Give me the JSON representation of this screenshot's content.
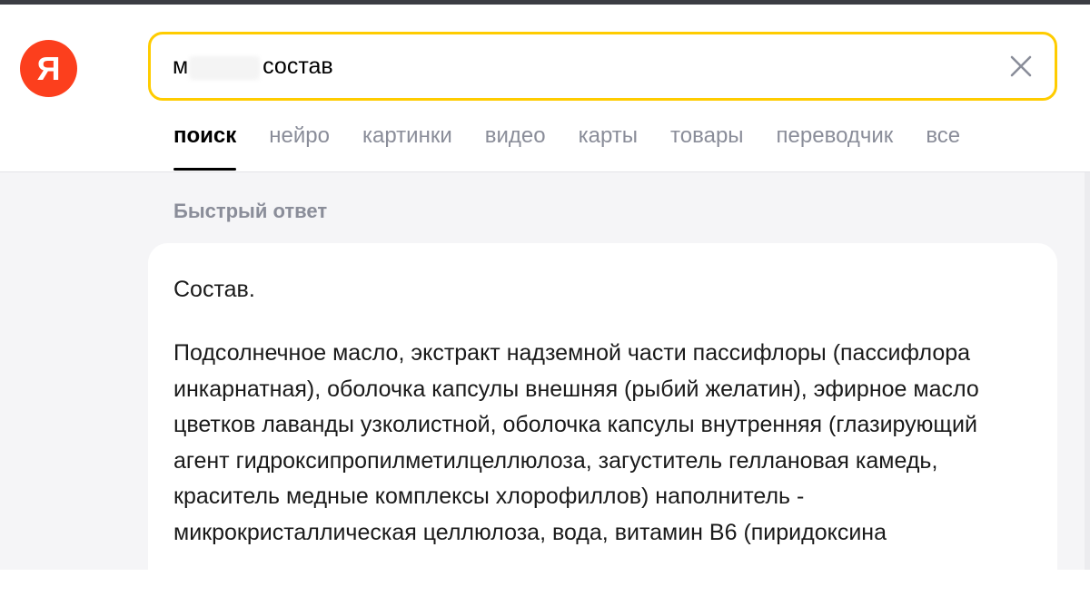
{
  "logo": {
    "letter": "Я"
  },
  "search": {
    "query": "м         с состав",
    "placeholder": ""
  },
  "tabs": [
    {
      "label": "поиск",
      "active": true
    },
    {
      "label": "нейро",
      "active": false
    },
    {
      "label": "картинки",
      "active": false
    },
    {
      "label": "видео",
      "active": false
    },
    {
      "label": "карты",
      "active": false
    },
    {
      "label": "товары",
      "active": false
    },
    {
      "label": "переводчик",
      "active": false
    },
    {
      "label": "все",
      "active": false
    }
  ],
  "quick_answer": {
    "label": "Быстрый ответ",
    "heading": "Состав.",
    "body": "Подсолнечное масло, экстракт надземной части пассифлоры (пассифлора инкарнатная), оболочка капсулы внешняя (рыбий желатин), эфирное масло цветков лаванды узколистной, оболочка капсулы внутренняя (глазирующий агент гидроксипропилметилцеллюлоза, загуститель геллановая камедь, краситель медные комплексы хлорофиллов) наполнитель - микрокристаллическая целлюлоза, вода, витамин B6 (пиридоксина"
  },
  "colors": {
    "logo_bg": "#fc3f1d",
    "search_border": "#ffcc00",
    "tab_inactive": "#8a8d99",
    "page_bg": "#f5f5f7"
  }
}
